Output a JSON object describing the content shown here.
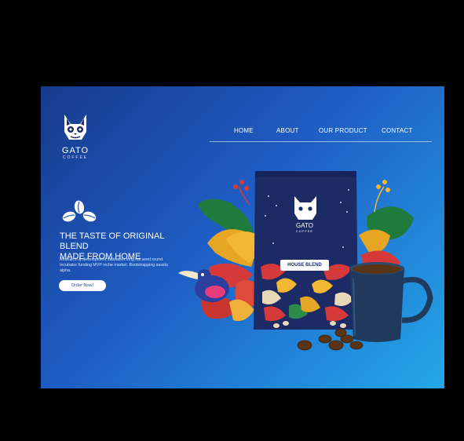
{
  "brand": {
    "name": "GATO",
    "subtitle": "COFFEE"
  },
  "nav": {
    "items": [
      "HOME",
      "ABOUT",
      "OUR PRODUCT",
      "CONTACT"
    ]
  },
  "hero": {
    "headline_line1": "THE TASTE OF ORIGINAL BLEND",
    "headline_line2": "MADE FROM HOME",
    "body": "Research & development validation long tail seed round. Incubator funding MVP niche market. Bootstrapping assets alpha.",
    "cta_label": "Order Now!"
  },
  "product": {
    "label": "HOUSE BLEND",
    "brand": "GATO",
    "brand_sub": "COFFEE"
  },
  "icons": [
    "cat-logo-icon",
    "coffee-beans-icon",
    "coffee-mug-icon"
  ],
  "colors": {
    "gradient_start": "#173a8c",
    "gradient_end": "#24a8ea",
    "bag": "#1c2a66",
    "mug": "#1f3a5c"
  }
}
